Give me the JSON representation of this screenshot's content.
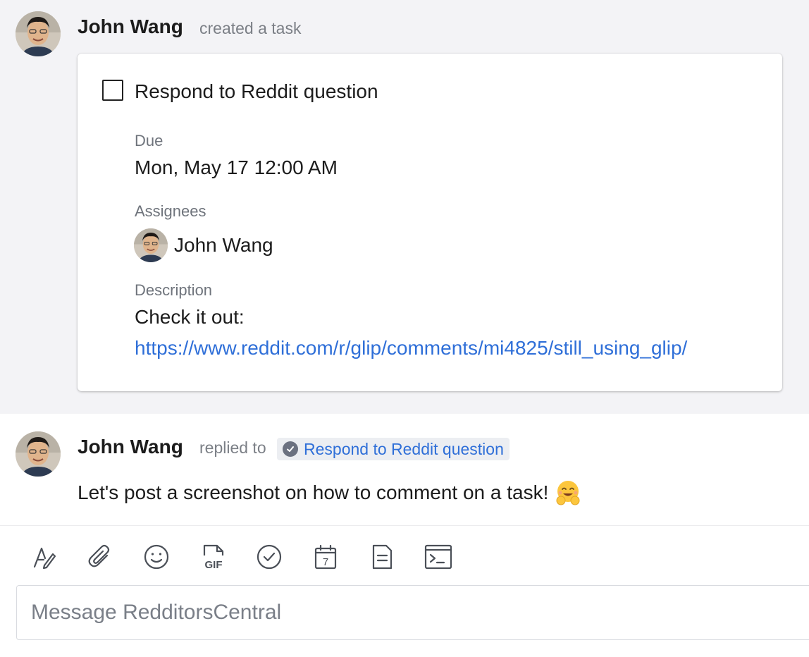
{
  "post1": {
    "author": "John Wang",
    "action": "created a task",
    "task": {
      "title": "Respond to Reddit question",
      "completed": false,
      "due_label": "Due",
      "due_value": "Mon, May 17 12:00 AM",
      "assignees_label": "Assignees",
      "assignees": [
        {
          "name": "John Wang"
        }
      ],
      "description_label": "Description",
      "description_text": "Check it out:",
      "description_link": "https://www.reddit.com/r/glip/comments/mi4825/still_using_glip/"
    }
  },
  "post2": {
    "author": "John Wang",
    "action": "replied to",
    "reply_target": "Respond to Reddit question",
    "message": "Let's post a screenshot on how to comment on a task!",
    "emoji": "hugging-face-emoji"
  },
  "composer": {
    "tools": [
      "format-text-icon",
      "attach-file-icon",
      "emoji-icon",
      "gif-icon",
      "task-icon",
      "event-calendar-icon",
      "note-icon",
      "code-snippet-icon"
    ],
    "gif_label": "GIF",
    "calendar_day": "7",
    "placeholder": "Message RedditorsCentral"
  },
  "colors": {
    "link": "#2f6fd8",
    "highlight_bg": "#f3f3f6",
    "muted_text": "#7b7f86"
  }
}
